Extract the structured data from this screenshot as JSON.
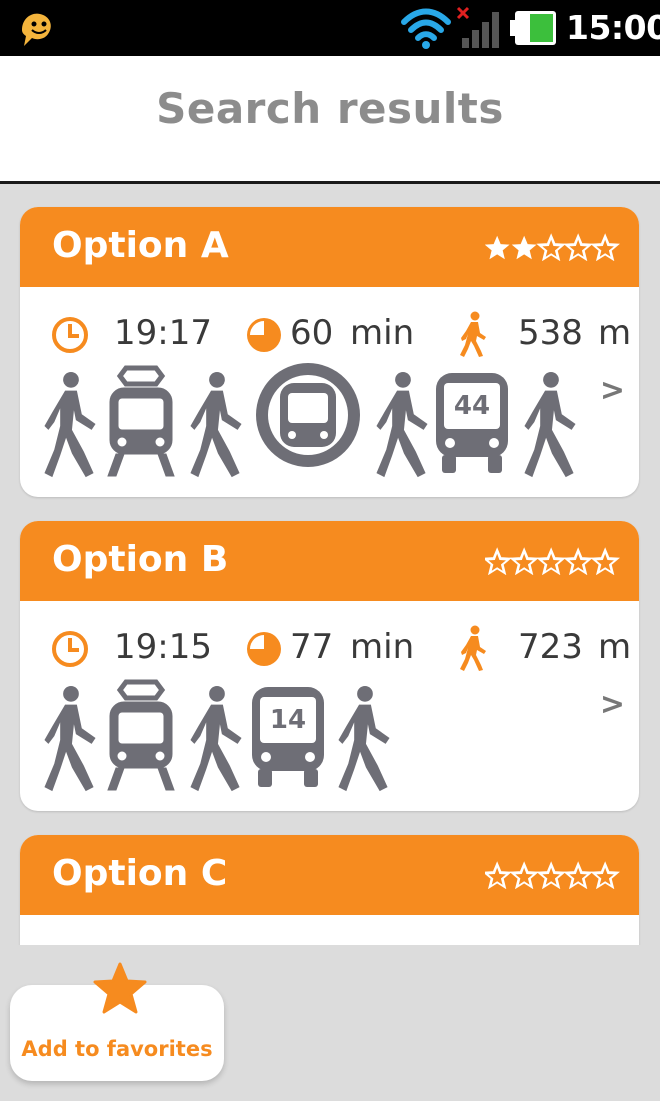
{
  "status_bar": {
    "time": "15:00"
  },
  "header": {
    "title": "Search results"
  },
  "options": [
    {
      "title": "Option A",
      "rating": 2,
      "rating_max": 5,
      "departure": "19:17",
      "duration": "60",
      "duration_unit": "min",
      "walk": "538",
      "walk_unit": "m",
      "legs": [
        "walk",
        "tram",
        "walk",
        "metro",
        "walk",
        "bus 44",
        "walk"
      ]
    },
    {
      "title": "Option B",
      "rating": 0,
      "rating_max": 5,
      "departure": "19:15",
      "duration": "77",
      "duration_unit": "min",
      "walk": "723",
      "walk_unit": "m",
      "legs": [
        "walk",
        "tram",
        "walk",
        "bus 14",
        "walk"
      ]
    },
    {
      "title": "Option C",
      "rating": 0,
      "rating_max": 5
    }
  ],
  "bus_numbers": {
    "a": "44",
    "b": "14"
  },
  "chevron": ">",
  "favorites": {
    "label": "Add to favorites"
  },
  "colors": {
    "accent": "#f68b1f",
    "icon_gray": "#6e6e76",
    "background": "#dcdcdc"
  }
}
